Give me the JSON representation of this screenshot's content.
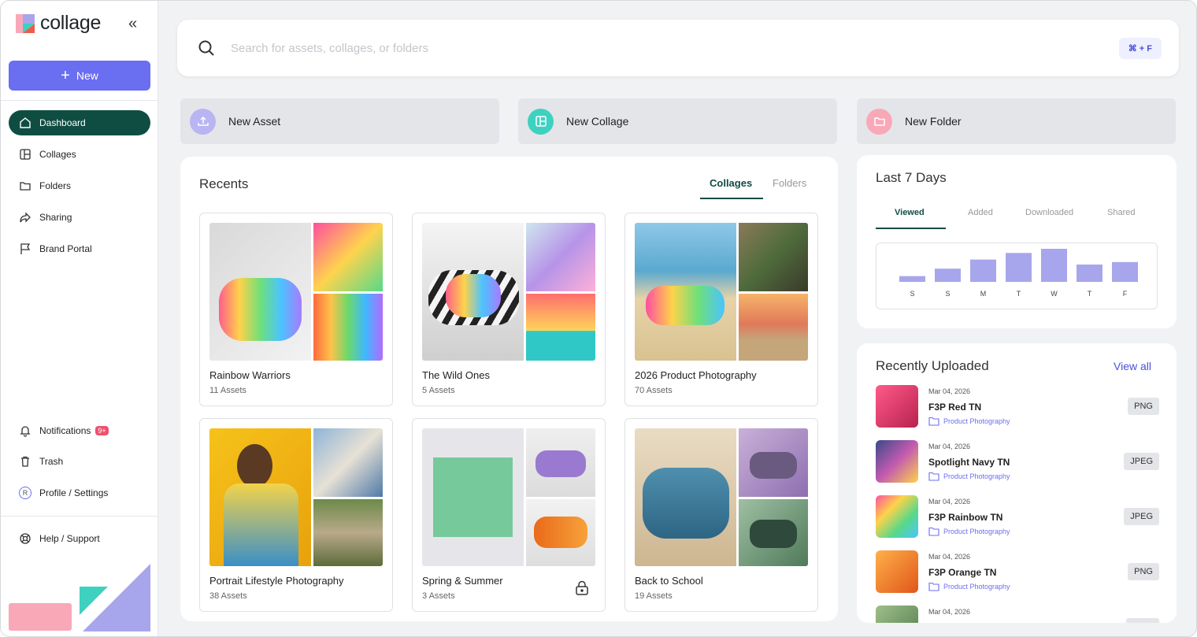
{
  "app": {
    "name": "collage",
    "collapse_icon": "chevrons-left-icon"
  },
  "sidebar": {
    "new_label": "New",
    "items": [
      {
        "label": "Dashboard",
        "icon": "home-icon",
        "active": true
      },
      {
        "label": "Collages",
        "icon": "layout-icon"
      },
      {
        "label": "Folders",
        "icon": "folder-icon"
      },
      {
        "label": "Sharing",
        "icon": "share-icon"
      },
      {
        "label": "Brand Portal",
        "icon": "flag-icon"
      }
    ],
    "bottom": {
      "notifications": "Notifications",
      "notifications_badge": "9+",
      "trash": "Trash",
      "profile": "Profile / Settings",
      "profile_initial": "R",
      "help": "Help / Support"
    }
  },
  "search": {
    "placeholder": "Search for assets, collages, or folders",
    "shortcut": "⌘ + F"
  },
  "quick_actions": [
    {
      "label": "New Asset",
      "icon": "upload-icon",
      "color": "#b9b4f2"
    },
    {
      "label": "New Collage",
      "icon": "layout-icon",
      "color": "#3ed1c0"
    },
    {
      "label": "New Folder",
      "icon": "folder-icon",
      "color": "#f9a8b8"
    }
  ],
  "recents": {
    "title": "Recents",
    "tabs": [
      "Collages",
      "Folders"
    ],
    "active_tab": "Collages",
    "cards": [
      {
        "title": "Rainbow Warriors",
        "subtitle": "11 Assets"
      },
      {
        "title": "The Wild Ones",
        "subtitle": "5 Assets"
      },
      {
        "title": "2026 Product Photography",
        "subtitle": "70 Assets"
      },
      {
        "title": "Portrait Lifestyle Photography",
        "subtitle": "38 Assets"
      },
      {
        "title": "Spring & Summer",
        "subtitle": "3 Assets",
        "locked": true
      },
      {
        "title": "Back to School",
        "subtitle": "19 Assets"
      }
    ]
  },
  "last7": {
    "title": "Last 7 Days",
    "tabs": [
      "Viewed",
      "Added",
      "Downloaded",
      "Shared"
    ],
    "active_tab": "Viewed"
  },
  "chart_data": {
    "type": "bar",
    "categories": [
      "S",
      "S",
      "M",
      "T",
      "W",
      "T",
      "F"
    ],
    "values": [
      7,
      16,
      27,
      35,
      40,
      21,
      24
    ],
    "color": "#a7a6ec"
  },
  "uploads": {
    "title": "Recently Uploaded",
    "view_all": "View all",
    "items": [
      {
        "date": "Mar 04, 2026",
        "name": "F3P Red TN",
        "folder": "Product Photography",
        "ext": "PNG"
      },
      {
        "date": "Mar 04, 2026",
        "name": "Spotlight Navy TN",
        "folder": "Product Photography",
        "ext": "JPEG"
      },
      {
        "date": "Mar 04, 2026",
        "name": "F3P Rainbow TN",
        "folder": "Product Photography",
        "ext": "JPEG"
      },
      {
        "date": "Mar 04, 2026",
        "name": "F3P Orange TN",
        "folder": "Product Photography",
        "ext": "PNG"
      },
      {
        "date": "Mar 04, 2026",
        "name": "",
        "folder": "",
        "ext": ""
      }
    ]
  }
}
